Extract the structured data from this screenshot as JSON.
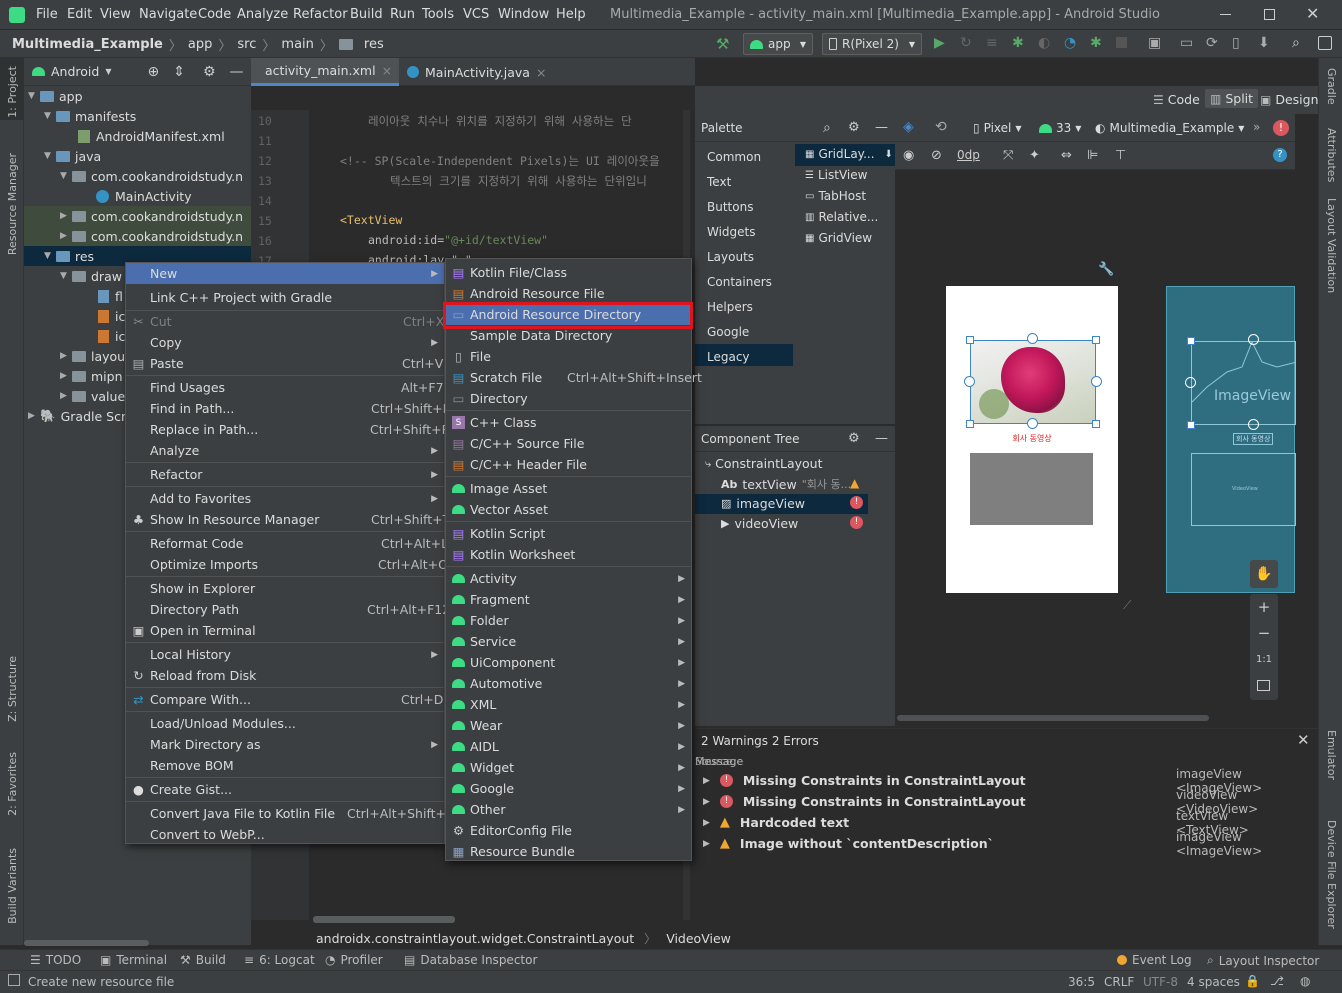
{
  "titlebar": {
    "menu": [
      "File",
      "Edit",
      "View",
      "Navigate",
      "Code",
      "Analyze",
      "Refactor",
      "Build",
      "Run",
      "Tools",
      "VCS",
      "Window",
      "Help"
    ],
    "title": "Multimedia_Example - activity_main.xml [Multimedia_Example.app] - Android Studio"
  },
  "nav": {
    "crumbs": [
      "Multimedia_Example",
      "app",
      "src",
      "main",
      "res"
    ],
    "run_config": "app",
    "device": "R(Pixel 2)"
  },
  "left_strip": {
    "project": "1: Project",
    "resource_manager": "Resource Manager",
    "structure": "Z: Structure",
    "favorites": "2: Favorites",
    "build_variants": "Build Variants"
  },
  "right_strip": {
    "gradle": "Gradle",
    "attributes": "Attributes",
    "layout_validation": "Layout Validation",
    "emulator": "Emulator",
    "device_file_explorer": "Device File Explorer"
  },
  "project": {
    "view": "Android",
    "tree": [
      "app",
      "manifests",
      "AndroidManifest.xml",
      "java",
      "com.cookandroidstudy.n",
      "MainActivity",
      "com.cookandroidstudy.n",
      "com.cookandroidstudy.n",
      "res",
      "draw",
      "fl",
      "ic",
      "ic",
      "layou",
      "mipn",
      "value",
      "Gradle Scrip"
    ]
  },
  "tabs": [
    "activity_main.xml",
    "MainActivity.java"
  ],
  "code": {
    "lines": [
      "10",
      "11",
      "12",
      "13",
      "14",
      "15",
      "16",
      "17"
    ],
    "l10": "레이아웃 치수나 위치를 지정하기 위해 사용하는 단",
    "l12": "<!--   SP(Scale-Independent Pixels)는 UI 레이아웃을",
    "l13": "텍스트의 크기를 지정하기 위해 사용하는 단위입니",
    "l15": "<TextView",
    "l16a": "android:id=",
    "l16b": "\"@+id/textView\"",
    "l17": "android:lay         \"                  \""
  },
  "design": {
    "modes": [
      "Code",
      "Split",
      "Design"
    ],
    "device": "Pixel",
    "api": "33",
    "theme": "Multimedia_Example",
    "margin": "0dp",
    "imageview_label": "ImageView",
    "caption": "회사 동영상",
    "blueprint_caption": "회사 동영상",
    "blueprint_video": "VideoView"
  },
  "palette": {
    "title": "Palette",
    "categories": [
      "Common",
      "Text",
      "Buttons",
      "Widgets",
      "Layouts",
      "Containers",
      "Helpers",
      "Google",
      "Legacy"
    ],
    "items": [
      "GridLay...",
      "ListView",
      "TabHost",
      "Relative...",
      "GridView"
    ]
  },
  "component_tree": {
    "title": "Component Tree",
    "items": [
      "ConstraintLayout",
      "textView",
      "\"회사 동...",
      "imageView",
      "videoView"
    ]
  },
  "context_menu": {
    "items": [
      {
        "label": "New",
        "shortcut": "",
        "sub": true
      },
      {
        "label": "Link C++ Project with Gradle",
        "shortcut": ""
      },
      {
        "label": "Cut",
        "shortcut": "Ctrl+X"
      },
      {
        "label": "Copy",
        "shortcut": "",
        "sub": true
      },
      {
        "label": "Paste",
        "shortcut": "Ctrl+V"
      },
      {
        "label": "Find Usages",
        "shortcut": "Alt+F7"
      },
      {
        "label": "Find in Path...",
        "shortcut": "Ctrl+Shift+F"
      },
      {
        "label": "Replace in Path...",
        "shortcut": "Ctrl+Shift+R"
      },
      {
        "label": "Analyze",
        "shortcut": "",
        "sub": true
      },
      {
        "label": "Refactor",
        "shortcut": "",
        "sub": true
      },
      {
        "label": "Add to Favorites",
        "shortcut": "",
        "sub": true
      },
      {
        "label": "Show In Resource Manager",
        "shortcut": "Ctrl+Shift+T"
      },
      {
        "label": "Reformat Code",
        "shortcut": "Ctrl+Alt+L"
      },
      {
        "label": "Optimize Imports",
        "shortcut": "Ctrl+Alt+O"
      },
      {
        "label": "Show in Explorer",
        "shortcut": ""
      },
      {
        "label": "Directory Path",
        "shortcut": "Ctrl+Alt+F12"
      },
      {
        "label": "Open in Terminal",
        "shortcut": ""
      },
      {
        "label": "Local History",
        "shortcut": "",
        "sub": true
      },
      {
        "label": "Reload from Disk",
        "shortcut": ""
      },
      {
        "label": "Compare With...",
        "shortcut": "Ctrl+D"
      },
      {
        "label": "Load/Unload Modules...",
        "shortcut": ""
      },
      {
        "label": "Mark Directory as",
        "shortcut": "",
        "sub": true
      },
      {
        "label": "Remove BOM",
        "shortcut": ""
      },
      {
        "label": "Create Gist...",
        "shortcut": ""
      },
      {
        "label": "Convert Java File to Kotlin File",
        "shortcut": "Ctrl+Alt+Shift+K"
      },
      {
        "label": "Convert to WebP...",
        "shortcut": ""
      }
    ]
  },
  "new_menu": {
    "items": [
      {
        "label": "Kotlin File/Class",
        "shortcut": ""
      },
      {
        "label": "Android Resource File",
        "shortcut": ""
      },
      {
        "label": "Android Resource Directory",
        "shortcut": ""
      },
      {
        "label": "Sample Data Directory",
        "shortcut": ""
      },
      {
        "label": "File",
        "shortcut": ""
      },
      {
        "label": "Scratch File",
        "shortcut": "Ctrl+Alt+Shift+Insert"
      },
      {
        "label": "Directory",
        "shortcut": ""
      },
      {
        "label": "C++ Class",
        "shortcut": ""
      },
      {
        "label": "C/C++ Source File",
        "shortcut": ""
      },
      {
        "label": "C/C++ Header File",
        "shortcut": ""
      },
      {
        "label": "Image Asset",
        "shortcut": ""
      },
      {
        "label": "Vector Asset",
        "shortcut": ""
      },
      {
        "label": "Kotlin Script",
        "shortcut": ""
      },
      {
        "label": "Kotlin Worksheet",
        "shortcut": ""
      },
      {
        "label": "Activity",
        "shortcut": "",
        "sub": true
      },
      {
        "label": "Fragment",
        "shortcut": "",
        "sub": true
      },
      {
        "label": "Folder",
        "shortcut": "",
        "sub": true
      },
      {
        "label": "Service",
        "shortcut": "",
        "sub": true
      },
      {
        "label": "UiComponent",
        "shortcut": "",
        "sub": true
      },
      {
        "label": "Automotive",
        "shortcut": "",
        "sub": true
      },
      {
        "label": "XML",
        "shortcut": "",
        "sub": true
      },
      {
        "label": "Wear",
        "shortcut": "",
        "sub": true
      },
      {
        "label": "AIDL",
        "shortcut": "",
        "sub": true
      },
      {
        "label": "Widget",
        "shortcut": "",
        "sub": true
      },
      {
        "label": "Google",
        "shortcut": "",
        "sub": true
      },
      {
        "label": "Other",
        "shortcut": "",
        "sub": true
      },
      {
        "label": "EditorConfig File",
        "shortcut": ""
      },
      {
        "label": "Resource Bundle",
        "shortcut": ""
      }
    ]
  },
  "problems": {
    "summary": "2 Warnings 2 Errors",
    "col_a": "Message",
    "col_b": "Source",
    "rows": [
      {
        "type": "error",
        "message": "Missing Constraints in ConstraintLayout",
        "source": "imageView <ImageView>"
      },
      {
        "type": "error",
        "message": "Missing Constraints in ConstraintLayout",
        "source": "videoView <VideoView>"
      },
      {
        "type": "warning",
        "message": "Hardcoded text",
        "source": "textView <TextView>"
      },
      {
        "type": "warning",
        "message": "Image without `contentDescription`",
        "source": "imageView <ImageView>"
      }
    ]
  },
  "breadcrumb": [
    "androidx.constraintlayout.widget.ConstraintLayout",
    "VideoView"
  ],
  "zoom": {
    "fit": "1:1"
  },
  "toolwindows": [
    "TODO",
    "Terminal",
    "Build",
    "6: Logcat",
    "Profiler",
    "Database Inspector",
    "Event Log",
    "Layout Inspector"
  ],
  "status": {
    "message": "Create new resource file",
    "position": "36:5",
    "line_sep": "CRLF",
    "encoding": "UTF-8",
    "indent": "4 spaces"
  },
  "colors": {
    "selection": "#4b6eaf",
    "highlight_box": "#e0141e",
    "error": "#db5860",
    "warning": "#f0a732",
    "android": "#3ddc84",
    "blueprint": "#2f6e80"
  }
}
